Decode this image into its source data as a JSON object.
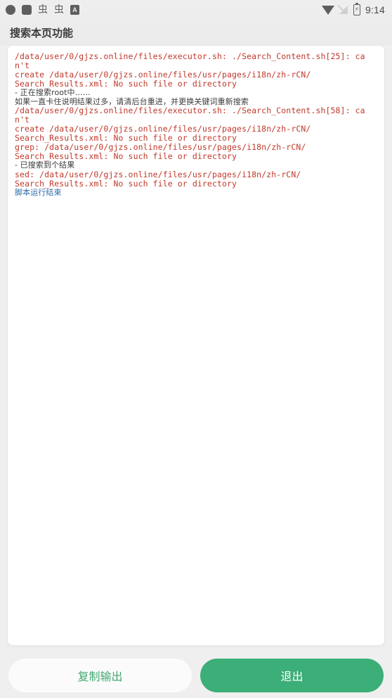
{
  "statusbar": {
    "left_icons": [
      {
        "name": "notification-dot-icon",
        "glyph": ""
      },
      {
        "name": "notification-square-icon",
        "glyph": ""
      },
      {
        "name": "bug-notification-icon-1",
        "glyph": "虫"
      },
      {
        "name": "bug-notification-icon-2",
        "glyph": "虫"
      },
      {
        "name": "ime-indicator-icon",
        "glyph": "A"
      }
    ],
    "right_icons": [
      {
        "name": "wifi-icon"
      },
      {
        "name": "mobile-signal-off-icon"
      },
      {
        "name": "battery-charging-icon",
        "glyph": "⚡"
      }
    ],
    "time": "9:14"
  },
  "header": {
    "title": "搜索本页功能"
  },
  "output": {
    "lines": [
      {
        "text": "/data/user/0/gjzs.online/files/executor.sh: ./Search_Content.sh[25]: can't",
        "color": "red"
      },
      {
        "text": "create /data/user/0/gjzs.online/files/usr/pages/i18n/zh-rCN/",
        "color": "red"
      },
      {
        "text": "Search_Results.xml: No such file or directory",
        "color": "red"
      },
      {
        "text": "- 正在搜索root中……",
        "color": "dark"
      },
      {
        "text": "如果一直卡住说明结果过多，请清后台重进，并更换关键词重新搜索",
        "color": "dark"
      },
      {
        "text": "/data/user/0/gjzs.online/files/executor.sh: ./Search_Content.sh[58]: can't",
        "color": "red"
      },
      {
        "text": "create /data/user/0/gjzs.online/files/usr/pages/i18n/zh-rCN/",
        "color": "red"
      },
      {
        "text": "Search_Results.xml: No such file or directory",
        "color": "red"
      },
      {
        "text": "grep: /data/user/0/gjzs.online/files/usr/pages/i18n/zh-rCN/",
        "color": "red"
      },
      {
        "text": "Search_Results.xml: No such file or directory",
        "color": "red"
      },
      {
        "text": "- 已搜索到个结果",
        "color": "dark"
      },
      {
        "text": "sed: /data/user/0/gjzs.online/files/usr/pages/i18n/zh-rCN/",
        "color": "red"
      },
      {
        "text": "Search_Results.xml: No such file or directory",
        "color": "red"
      },
      {
        "text": "脚本运行结束",
        "color": "blue"
      }
    ]
  },
  "footer": {
    "copy_label": "复制输出",
    "exit_label": "退出"
  },
  "colors": {
    "accent_green": "#3cae78",
    "error_red": "#c0392b",
    "info_blue": "#2d6aa8",
    "page_background": "#efefef"
  }
}
